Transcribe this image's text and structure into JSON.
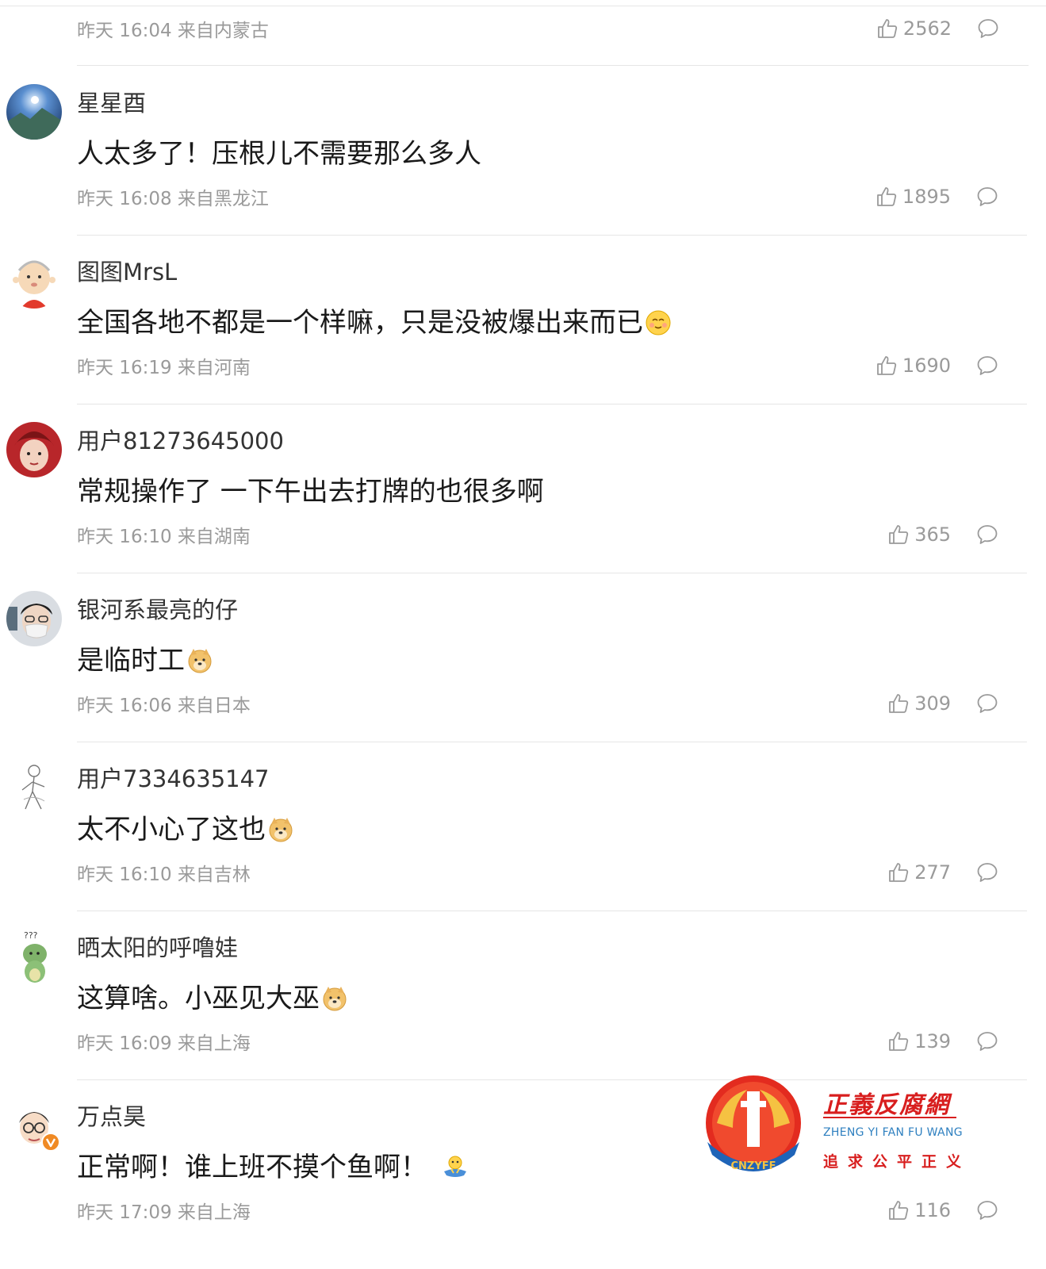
{
  "first_meta": {
    "time": "昨天 16:04 来自内蒙古",
    "likes": "2562"
  },
  "comments": [
    {
      "username": "星星酉",
      "text": "人太多了！压根儿不需要那么多人",
      "emoji": "",
      "time": "昨天 16:08 来自黑龙江",
      "likes": "1895",
      "avatar": "galaxy-avatar"
    },
    {
      "username": "图图MrsL",
      "text": "全国各地不都是一个样嘛，只是没被爆出来而已",
      "emoji": "smile-emoji",
      "time": "昨天 16:19 来自河南",
      "likes": "1690",
      "avatar": "cartoon-boy-avatar"
    },
    {
      "username": "用户81273645000",
      "text": "常规操作了 一下午出去打牌的也很多啊",
      "emoji": "",
      "time": "昨天 16:10 来自湖南",
      "likes": "365",
      "avatar": "red-hood-avatar"
    },
    {
      "username": "银河系最亮的仔",
      "text": "是临时工",
      "emoji": "doge-emoji",
      "time": "昨天 16:06 来自日本",
      "likes": "309",
      "avatar": "masked-boy-avatar"
    },
    {
      "username": "用户7334635147",
      "text": "太不小心了这也",
      "emoji": "doge-emoji",
      "time": "昨天 16:10 来自吉林",
      "likes": "277",
      "avatar": "sketch-avatar"
    },
    {
      "username": "晒太阳的呼噜娃",
      "text": "这算啥。小巫见大巫",
      "emoji": "doge-emoji",
      "time": "昨天 16:09 来自上海",
      "likes": "139",
      "avatar": "dinosaur-avatar"
    },
    {
      "username": "万点昊",
      "text": "正常啊！谁上班不摸个鱼啊！",
      "emoji": "fishing-emoji",
      "time": "昨天 17:09 来自上海",
      "likes": "116",
      "avatar": "glasses-man-avatar"
    }
  ],
  "watermark": {
    "title": "正義反腐網",
    "subtitle": "ZHENG YI FAN FU WANG",
    "slogan": "追求公平正义",
    "badge_text": "CNZYFF"
  },
  "colors": {
    "meta_gray": "#9a9a9a",
    "divider": "#e6e6e6",
    "watermark_red": "#d81e1e",
    "watermark_blue": "#2f80c0"
  }
}
